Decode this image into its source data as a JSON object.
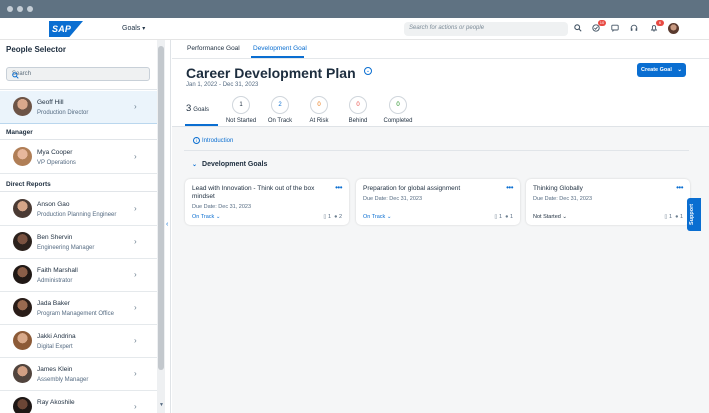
{
  "shell": {
    "logo": "SAP",
    "nav_label": "Goals",
    "search_placeholder": "Search for actions or people",
    "notifications_badge": "10",
    "bell_badge": "6"
  },
  "people_selector": {
    "title": "People Selector",
    "search_placeholder": "Search",
    "current": {
      "name": "Geoff Hill",
      "role": "Production Director"
    },
    "manager_heading": "Manager",
    "manager": {
      "name": "Mya Cooper",
      "role": "VP Operations"
    },
    "direct_reports_heading": "Direct Reports",
    "direct_reports": [
      {
        "name": "Anson Gao",
        "role": "Production Planning Engineer"
      },
      {
        "name": "Ben Shervin",
        "role": "Engineering Manager"
      },
      {
        "name": "Faith Marshall",
        "role": "Administrator"
      },
      {
        "name": "Jada Baker",
        "role": "Program Management Office"
      },
      {
        "name": "Jakki Andrina",
        "role": "Digital Expert"
      },
      {
        "name": "James Klein",
        "role": "Assembly Manager"
      },
      {
        "name": "Ray Akoshile",
        "role": ""
      }
    ]
  },
  "tabs": [
    {
      "label": "Performance Goal"
    },
    {
      "label": "Development Goal"
    }
  ],
  "plan": {
    "title": "Career Development Plan",
    "date_range": "Jan 1, 2022 - Dec 31, 2023",
    "create_button": "Create Goal"
  },
  "summary": {
    "goals_count": "3",
    "goals_label": "Goals",
    "stats": [
      {
        "value": "1",
        "label": "Not Started",
        "color": "#1d2d3e"
      },
      {
        "value": "2",
        "label": "On Track",
        "color": "#0a6ed1"
      },
      {
        "value": "0",
        "label": "At Risk",
        "color": "#e9730c"
      },
      {
        "value": "0",
        "label": "Behind",
        "color": "#e84a43"
      },
      {
        "value": "0",
        "label": "Completed",
        "color": "#188918"
      }
    ]
  },
  "introduction_label": "Introduction",
  "section_title": "Development Goals",
  "goal_cards": [
    {
      "title": "Lead with Innovation - Think out of the box mindset",
      "due": "Due Date: Dec 31, 2023",
      "status": "On Track",
      "attachments": "1",
      "comments": "2"
    },
    {
      "title": "Preparation for global assignment",
      "due": "Due Date: Dec 31, 2023",
      "status": "On Track",
      "attachments": "1",
      "comments": "1"
    },
    {
      "title": "Thinking Globally",
      "due": "Due Date: Dec 31, 2023",
      "status": "Not Started",
      "attachments": "1",
      "comments": "1"
    }
  ],
  "support_label": "Support",
  "colors": {
    "accent": "#0a6ed1",
    "selected_row": "#ebf4fb"
  }
}
